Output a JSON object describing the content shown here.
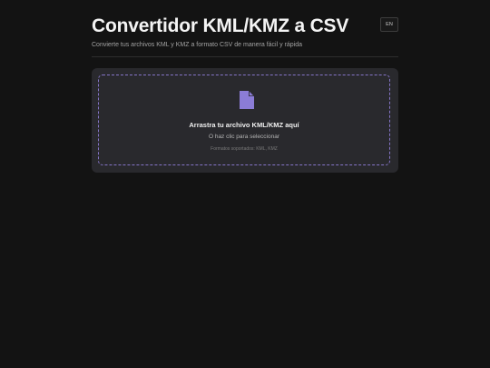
{
  "header": {
    "title": "Convertidor KML/KMZ a CSV",
    "subtitle": "Convierte tus archivos KML y KMZ a formato CSV de manera fácil y rápida",
    "language_button": "EN"
  },
  "dropzone": {
    "icon": "file-icon",
    "title": "Arrastra tu archivo KML/KMZ aquí",
    "hint": "O haz clic para seleccionar",
    "formats": "Formatos soportados: KML, KMZ"
  },
  "colors": {
    "background": "#131313",
    "card": "#29292d",
    "accent": "#8b7cd6",
    "dashed_border": "#8575c8"
  }
}
